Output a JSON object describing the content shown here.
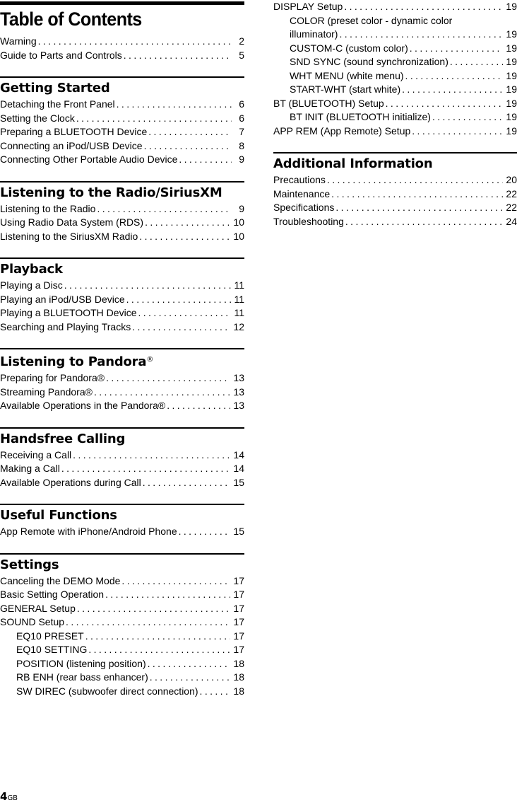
{
  "title": "Table of Contents",
  "intro_entries": [
    {
      "label": "Warning",
      "page": "2"
    },
    {
      "label": "Guide to Parts and Controls",
      "page": "5"
    }
  ],
  "sections": {
    "getting_started": {
      "heading": "Getting Started",
      "entries": [
        {
          "label": "Detaching the Front Panel",
          "page": "6"
        },
        {
          "label": "Setting the Clock",
          "page": "6"
        },
        {
          "label": "Preparing a BLUETOOTH Device",
          "page": "7"
        },
        {
          "label": "Connecting an iPod/USB Device",
          "page": "8"
        },
        {
          "label": "Connecting Other Portable Audio Device",
          "page": "9"
        }
      ]
    },
    "radio": {
      "heading": "Listening to the Radio/SiriusXM",
      "entries": [
        {
          "label": "Listening to the Radio",
          "page": "9"
        },
        {
          "label": "Using Radio Data System (RDS)",
          "page": "10"
        },
        {
          "label": "Listening to the SiriusXM Radio",
          "page": "10"
        }
      ]
    },
    "playback": {
      "heading": "Playback",
      "entries": [
        {
          "label": "Playing a Disc",
          "page": "11"
        },
        {
          "label": "Playing an iPod/USB Device",
          "page": "11"
        },
        {
          "label": "Playing a BLUETOOTH Device",
          "page": "11"
        },
        {
          "label": "Searching and Playing Tracks",
          "page": "12"
        }
      ]
    },
    "pandora": {
      "heading": "Listening to Pandora",
      "heading_mark": "®",
      "entries": [
        {
          "label": "Preparing for Pandora®",
          "page": "13"
        },
        {
          "label": "Streaming Pandora®",
          "page": "13"
        },
        {
          "label": "Available Operations in the Pandora®",
          "page": "13"
        }
      ]
    },
    "handsfree": {
      "heading": "Handsfree Calling",
      "entries": [
        {
          "label": "Receiving a Call",
          "page": "14"
        },
        {
          "label": "Making a Call",
          "page": "14"
        },
        {
          "label": "Available Operations during Call",
          "page": "15"
        }
      ]
    },
    "useful": {
      "heading": "Useful Functions",
      "entries": [
        {
          "label": "App Remote with iPhone/Android Phone",
          "page": "15"
        }
      ]
    },
    "settings": {
      "heading": "Settings",
      "entries": [
        {
          "label": "Canceling the DEMO Mode",
          "page": "17"
        },
        {
          "label": "Basic Setting Operation",
          "page": "17"
        },
        {
          "label": "GENERAL Setup",
          "page": "17"
        },
        {
          "label": "SOUND Setup",
          "page": "17"
        },
        {
          "label": "EQ10 PRESET",
          "page": "17"
        },
        {
          "label": "EQ10 SETTING",
          "page": "17"
        },
        {
          "label": "POSITION (listening position)",
          "page": "18"
        },
        {
          "label": "RB ENH (rear bass enhancer)",
          "page": "18"
        },
        {
          "label": "SW DIREC (subwoofer direct connection)",
          "page": "18"
        }
      ],
      "continued": [
        {
          "label": "DISPLAY Setup",
          "page": "19"
        },
        {
          "label_line1": "COLOR (preset color - dynamic color",
          "label": "illuminator)",
          "page": "19"
        },
        {
          "label": "CUSTOM-C (custom color)",
          "page": "19"
        },
        {
          "label": "SND SYNC (sound synchronization)",
          "page": "19"
        },
        {
          "label": "WHT MENU (white menu)",
          "page": "19"
        },
        {
          "label": "START-WHT (start white)",
          "page": "19"
        },
        {
          "label": "BT (BLUETOOTH) Setup",
          "page": "19"
        },
        {
          "label": "BT INIT (BLUETOOTH initialize)",
          "page": "19"
        },
        {
          "label": "APP REM (App Remote) Setup",
          "page": "19"
        }
      ]
    },
    "additional": {
      "heading": "Additional Information",
      "entries": [
        {
          "label": "Precautions",
          "page": "20"
        },
        {
          "label": "Maintenance",
          "page": "22"
        },
        {
          "label": "Specifications",
          "page": "22"
        },
        {
          "label": "Troubleshooting",
          "page": "24"
        }
      ]
    }
  },
  "footer": {
    "page_number": "4",
    "locale": "GB"
  }
}
